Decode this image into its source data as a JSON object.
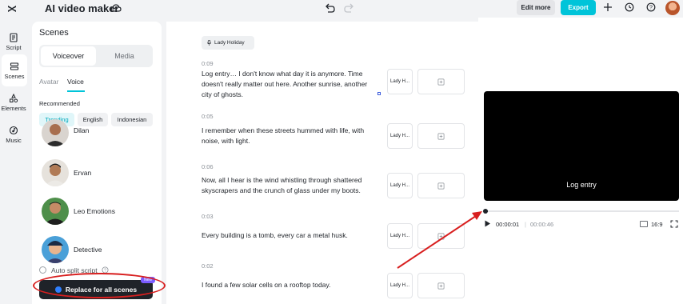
{
  "header": {
    "app_title": "AI video maker",
    "edit_more": "Edit more",
    "export": "Export"
  },
  "rail": [
    {
      "label": "Script",
      "icon": "script-icon"
    },
    {
      "label": "Scenes",
      "icon": "scenes-icon",
      "active": true
    },
    {
      "label": "Elements",
      "icon": "elements-icon"
    },
    {
      "label": "Music",
      "icon": "music-icon"
    }
  ],
  "scenes_panel": {
    "title": "Scenes",
    "tabs": [
      "Voiceover",
      "Media"
    ],
    "active_tab": "Voiceover",
    "subtabs": [
      "Avatar",
      "Voice"
    ],
    "active_subtab": "Voice",
    "recommended_label": "Recommended",
    "chips": [
      "Trending",
      "English",
      "Indonesian"
    ],
    "active_chip": "Trending",
    "voices": [
      "Dilan",
      "Ervan",
      "Leo Emotions",
      "Detective"
    ],
    "auto_split": "Auto split script",
    "replace_button": "Replace for all scenes",
    "new_badge": "New"
  },
  "script": {
    "speaker": "Lady Holiday",
    "scenes": [
      {
        "time": "0:09",
        "text": "Log entry… I don't know what day it is anymore. Time doesn't really matter out here. Another sunrise, another city of ghosts.",
        "voice": "Lady H..."
      },
      {
        "time": "0:05",
        "text": "I remember when these streets hummed with life, with noise, with light.",
        "voice": "Lady H..."
      },
      {
        "time": "0:06",
        "text": "Now, all I hear is the wind whistling through shattered skyscrapers and the crunch of glass under my boots.",
        "voice": "Lady H..."
      },
      {
        "time": "0:03",
        "text": "Every building is a tomb, every car a metal husk.",
        "voice": "Lady H..."
      },
      {
        "time": "0:02",
        "text": "I found a few solar cells on a rooftop today.",
        "voice": "Lady H..."
      }
    ]
  },
  "preview": {
    "caption": "Log entry",
    "current_time": "00:00:01",
    "separator": "|",
    "total_time": "00:00:46",
    "progress": 0.02,
    "aspect_ratio": "16:9"
  },
  "colors": {
    "accent": "#00c4d9",
    "annotation_red": "#d81f1f"
  }
}
